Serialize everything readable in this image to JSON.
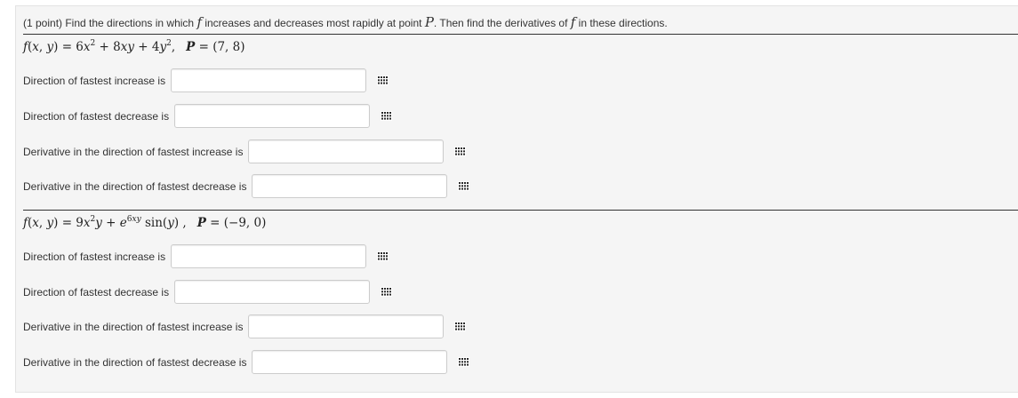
{
  "intro": {
    "prefix": "(1 point) Find the directions in which ",
    "f": "f",
    "middle": " increases and decreases most rapidly at point ",
    "P": "P",
    "suffix": ". Then find the derivatives of ",
    "f2": "f",
    "end": " in these directions."
  },
  "parts": [
    {
      "formula": {
        "lhs": "f(x, y)",
        "rhs": "= 6x² + 8xy + 4y²,",
        "point": "P = (7, 8)"
      },
      "rows": [
        {
          "label": "Direction of fastest increase is",
          "value": ""
        },
        {
          "label": "Direction of fastest decrease is",
          "value": ""
        },
        {
          "label": "Derivative in the direction of fastest increase is",
          "value": ""
        },
        {
          "label": "Derivative in the direction of fastest decrease is",
          "value": ""
        }
      ]
    },
    {
      "formula": {
        "lhs": "f(x, y)",
        "rhs": "= 9x²y + e^{6xy} sin(y) ,",
        "point": "P = (−9, 0)"
      },
      "rows": [
        {
          "label": "Direction of fastest increase is",
          "value": ""
        },
        {
          "label": "Direction of fastest decrease is",
          "value": ""
        },
        {
          "label": "Derivative in the direction of fastest increase is",
          "value": ""
        },
        {
          "label": "Derivative in the direction of fastest decrease is",
          "value": ""
        }
      ]
    }
  ],
  "icons": {
    "palette": "equation-palette-icon"
  },
  "colors": {
    "panel_bg": "#f5f5f5",
    "text": "#333333",
    "input_border": "#cccccc"
  }
}
